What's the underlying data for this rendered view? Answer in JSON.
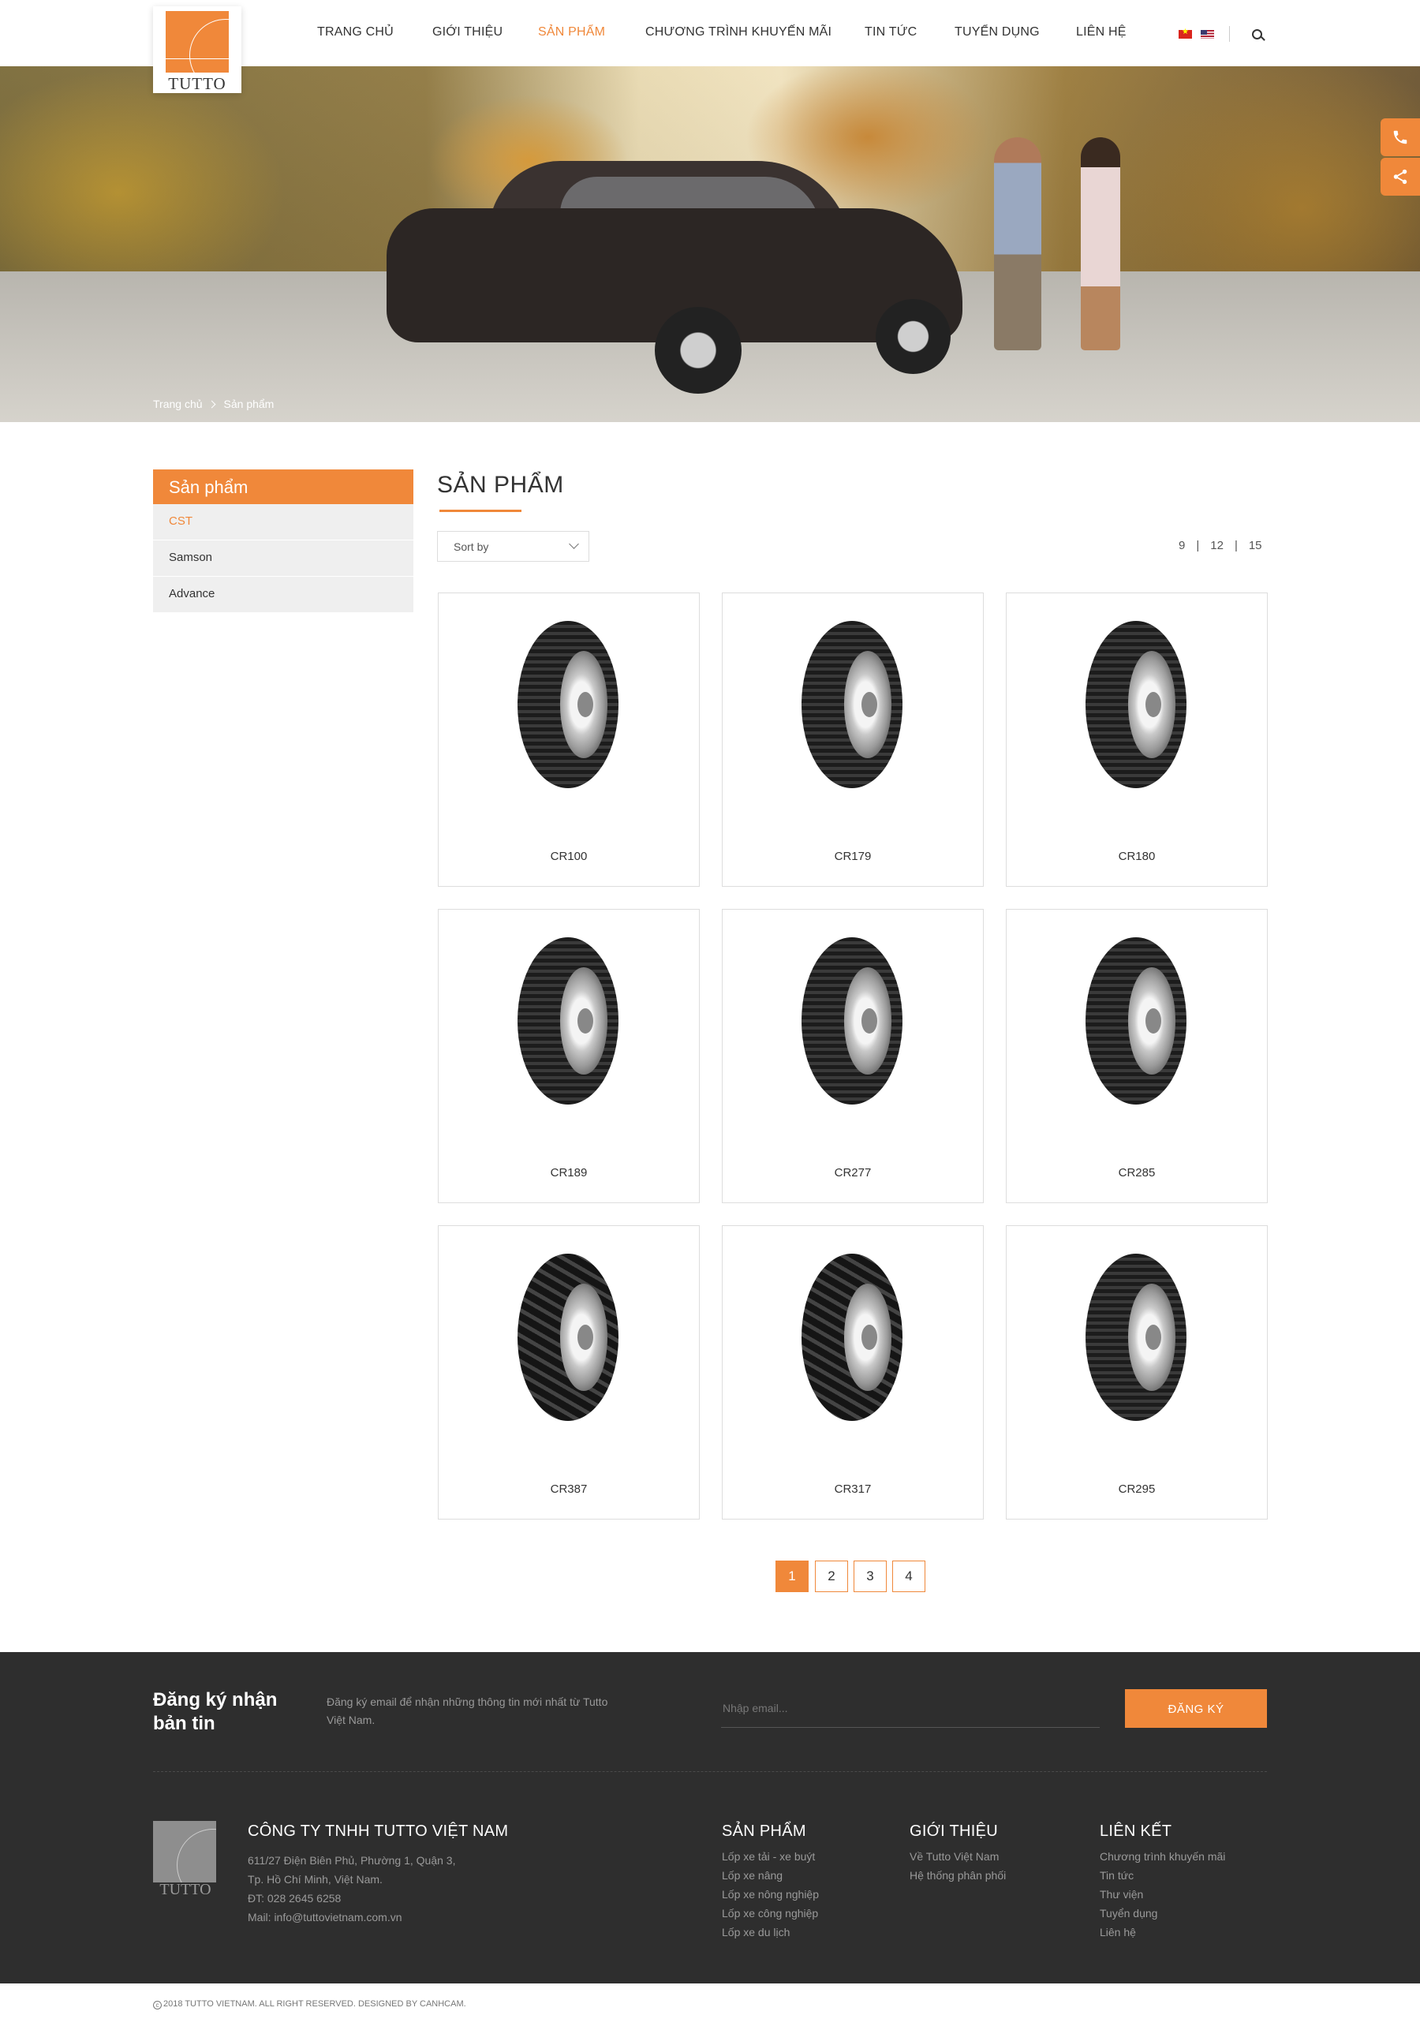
{
  "brand": {
    "logo_text": "TUTTO"
  },
  "nav": {
    "items": [
      {
        "label": "TRANG CHỦ"
      },
      {
        "label": "GIỚI THIỆU"
      },
      {
        "label": "SẢN PHẨM"
      },
      {
        "label": "CHƯƠNG TRÌNH KHUYẾN MÃI"
      },
      {
        "label": "TIN TỨC"
      },
      {
        "label": "TUYỂN DỤNG"
      },
      {
        "label": "LIÊN HỆ"
      }
    ],
    "active_index": 2
  },
  "breadcrumb": {
    "home": "Trang  chủ",
    "current": "Sản phẩm"
  },
  "sidebar": {
    "title": "Sản phẩm",
    "items": [
      {
        "label": "CST",
        "active": true
      },
      {
        "label": "Samson",
        "active": false
      },
      {
        "label": "Advance",
        "active": false
      }
    ]
  },
  "main": {
    "title": "SẢN PHẨM",
    "sort_placeholder": "Sort by",
    "per_page": [
      "9",
      "12",
      "15"
    ]
  },
  "products": [
    {
      "name": "CR100"
    },
    {
      "name": "CR179"
    },
    {
      "name": "CR180"
    },
    {
      "name": "CR189"
    },
    {
      "name": "CR277"
    },
    {
      "name": "CR285"
    },
    {
      "name": "CR387"
    },
    {
      "name": "CR317"
    },
    {
      "name": "CR295"
    }
  ],
  "pagination": {
    "pages": [
      "1",
      "2",
      "3",
      "4"
    ],
    "current": "1"
  },
  "footer": {
    "newsletter_title": "Đăng ký nhận bản tin",
    "newsletter_desc": "Đăng ký email để nhận những thông tin mới nhất từ Tutto Việt Nam.",
    "email_placeholder": "Nhập email...",
    "subscribe_label": "ĐĂNG KÝ",
    "logo_text": "TUTTO",
    "company": "CÔNG TY TNHH TUTTO VIỆT NAM",
    "address_lines": [
      "611/27 Điện Biên Phủ, Phường 1, Quận 3,",
      "Tp. Hồ Chí Minh, Việt Nam.",
      "ĐT: 028 2645 6258",
      "Mail: info@tuttovietnam.com.vn"
    ],
    "columns": [
      {
        "title": "SẢN PHẨM",
        "links": [
          "Lốp xe tải - xe buýt",
          "Lốp xe nâng",
          "Lốp xe nông nghiệp",
          "Lốp xe công nghiệp",
          "Lốp xe du lịch"
        ]
      },
      {
        "title": "GIỚI THIỆU",
        "links": [
          "Về Tutto Việt Nam",
          "Hệ thống phân phối"
        ]
      },
      {
        "title": "LIÊN KẾT",
        "links": [
          "Chương trình khuyến  mãi",
          "Tin tức",
          "Thư viện",
          "Tuyển dụng",
          "Liên hệ"
        ]
      }
    ],
    "copyright": "2018 TUTTO VIETNAM. ALL RIGHT RESERVED. DESIGNED BY CANHCAM."
  },
  "colors": {
    "accent": "#f0883a",
    "footer_bg": "#2e2e2e"
  },
  "icons": [
    "search-icon",
    "phone-icon",
    "share-icon",
    "chevron-down-icon",
    "chevron-right-icon",
    "copyright-icon"
  ]
}
